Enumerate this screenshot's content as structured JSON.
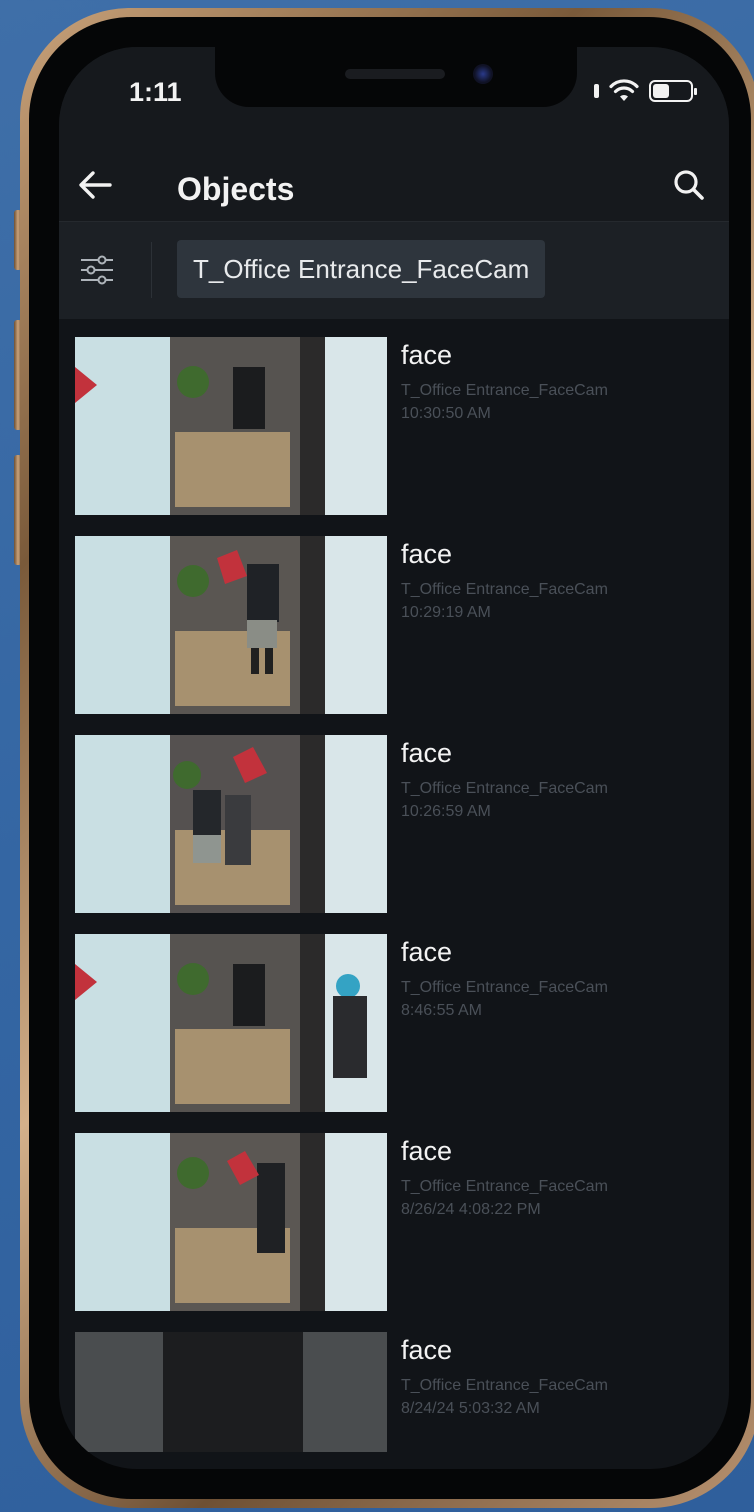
{
  "status_bar": {
    "time": "1:11"
  },
  "header": {
    "title": "Objects",
    "back_icon": "arrow-left-icon",
    "search_icon": "search-icon"
  },
  "filter": {
    "filter_icon": "sliders-icon",
    "camera_chip": "T_Office Entrance_FaceCam"
  },
  "objects": [
    {
      "type": "face",
      "camera": "T_Office Entrance_FaceCam",
      "time": "10:30:50 AM"
    },
    {
      "type": "face",
      "camera": "T_Office Entrance_FaceCam",
      "time": "10:29:19 AM"
    },
    {
      "type": "face",
      "camera": "T_Office Entrance_FaceCam",
      "time": "10:26:59 AM"
    },
    {
      "type": "face",
      "camera": "T_Office Entrance_FaceCam",
      "time": "8:46:55 AM"
    },
    {
      "type": "face",
      "camera": "T_Office Entrance_FaceCam",
      "time": "8/26/24 4:08:22 PM"
    },
    {
      "type": "face",
      "camera": "T_Office Entrance_FaceCam",
      "time": "8/24/24 5:03:32 AM"
    }
  ],
  "colors": {
    "background": "#111418",
    "app_bar": "#16191d",
    "chip": "#2e353d",
    "primary_text": "#f3f3f3",
    "secondary_text": "#4a5058"
  }
}
